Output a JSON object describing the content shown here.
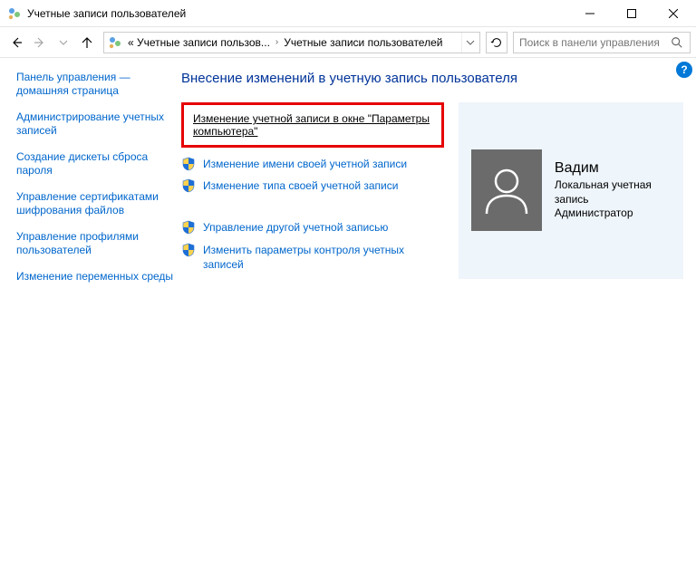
{
  "window": {
    "title": "Учетные записи пользователей"
  },
  "address": {
    "crumb1": "« Учетные записи пользов...",
    "crumb2": "Учетные записи пользователей"
  },
  "search": {
    "placeholder": "Поиск в панели управления"
  },
  "sidebar": {
    "items": [
      "Панель управления — домашняя страница",
      "Администрирование учетных записей",
      "Создание дискеты сброса пароля",
      "Управление сертификатами шифрования файлов",
      "Управление профилями пользователей",
      "Изменение переменных среды"
    ]
  },
  "main": {
    "heading": "Внесение изменений в учетную запись пользователя",
    "task_highlighted": "Изменение учетной записи в окне \"Параметры компьютера\"",
    "task_rename": "Изменение имени своей учетной записи",
    "task_changetype": "Изменение типа своей учетной записи",
    "task_other": "Управление другой учетной записью",
    "task_uac": "Изменить параметры контроля учетных записей"
  },
  "user": {
    "name": "Вадим",
    "acct_type": "Локальная учетная запись",
    "role": "Администратор"
  }
}
